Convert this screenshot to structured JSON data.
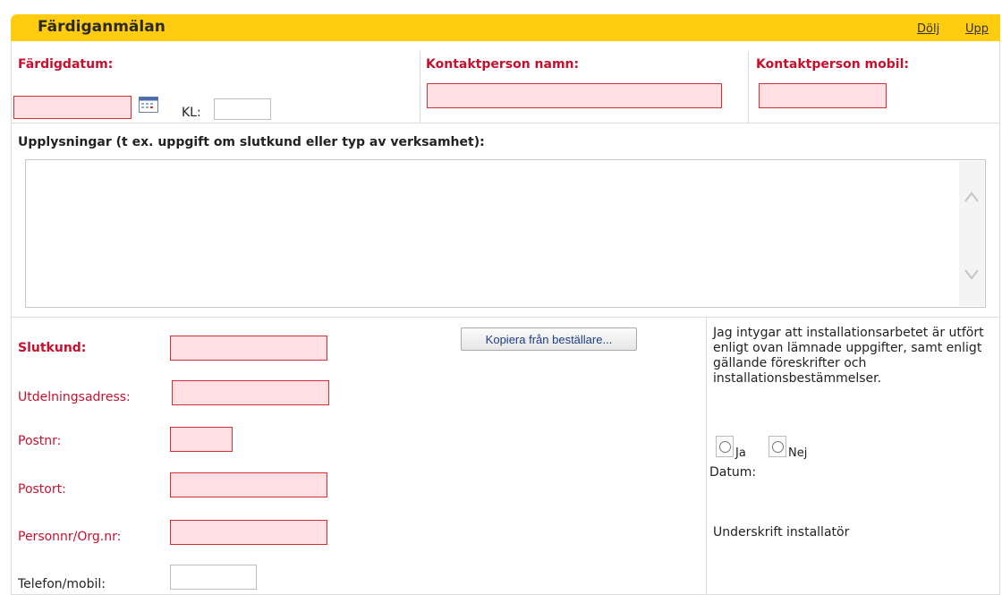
{
  "header": {
    "title": "Färdiganmälan",
    "hide_link": "Dölj",
    "up_link": "Upp"
  },
  "top_row": {
    "date_label": "Färdigdatum:",
    "time_label": "KL:",
    "contact_name_label": "Kontaktperson namn:",
    "contact_mobile_label": "Kontaktperson mobil:"
  },
  "info": {
    "label": "Upplysningar (t ex. uppgift om slutkund eller typ av verksamhet):"
  },
  "customer": {
    "end_customer_label": "Slutkund:",
    "address_label": "Utdelningsadress:",
    "postal_code_label": "Postnr:",
    "city_label": "Postort:",
    "id_label": "Personnr/Org.nr:",
    "phone_label": "Telefon/mobil:",
    "copy_button": "Kopiera från beställare..."
  },
  "certification": {
    "text": "Jag intygar att installationsarbetet är utfört enligt ovan lämnade uppgifter, samt enligt gällande föreskrifter och installationsbestämmelser.",
    "yes_label": "Ja",
    "no_label": "Nej",
    "date_label": "Datum:",
    "signature_label": "Underskrift installatör"
  },
  "icons": {
    "calendar": "calendar-icon",
    "scroll_up": "scroll-up-icon",
    "scroll_down": "scroll-down-icon"
  },
  "colors": {
    "header_bg": "#ffcc0f",
    "required_label": "#c8102e",
    "required_field_bg": "#ffdfe3",
    "required_field_border": "#d23131"
  }
}
